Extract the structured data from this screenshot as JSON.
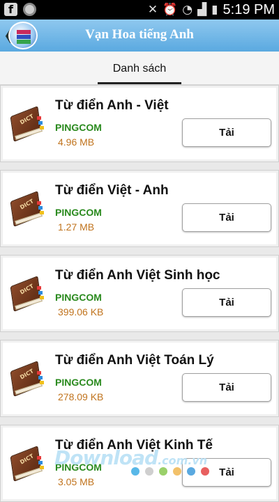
{
  "status_bar": {
    "time": "5:19 PM",
    "battery": "battery-icon",
    "icons": [
      "facebook-icon",
      "circle-icon",
      "mute-icon",
      "alarm-icon",
      "wifi-icon",
      "signal-icon",
      "battery-icon"
    ]
  },
  "app_bar": {
    "title": "Vạn Hoa tiếng Anh",
    "back_glyph": "❮"
  },
  "tabs": [
    {
      "label": "Danh sách",
      "active": true
    }
  ],
  "dictionaries": [
    {
      "name": "Từ điển Anh -  Việt",
      "publisher": "PINGCOM",
      "size": "4.96 MB",
      "action": "Tải"
    },
    {
      "name": "Từ điển Việt - Anh",
      "publisher": "PINGCOM",
      "size": "1.27 MB",
      "action": "Tải"
    },
    {
      "name": "Từ điển Anh Việt Sinh học",
      "publisher": "PINGCOM",
      "size": "399.06 KB",
      "action": "Tải"
    },
    {
      "name": "Từ điển Anh Việt Toán Lý",
      "publisher": "PINGCOM",
      "size": "278.09 KB",
      "action": "Tải"
    },
    {
      "name": "Từ điển Anh Việt Kinh Tế",
      "publisher": "PINGCOM",
      "size": "3.05 MB",
      "action": "Tải"
    }
  ],
  "book_label": "DICT",
  "watermark": {
    "main": "Download",
    "suffix": ".com.vn",
    "dot_colors": [
      "#58b8e8",
      "#cfcfcf",
      "#9ad06a",
      "#f2c16a",
      "#5aa9e0",
      "#e86060"
    ]
  },
  "colors": {
    "publisher": "#2a8a1e",
    "size": "#c0731d",
    "app_bar": "#6fb6e6"
  }
}
